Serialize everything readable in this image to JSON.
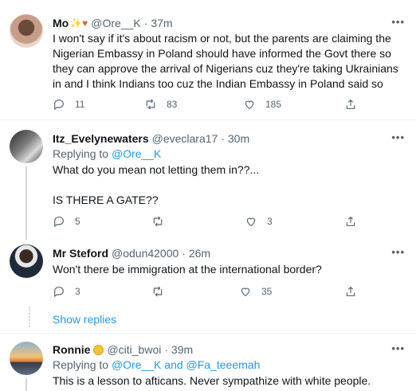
{
  "tweets": [
    {
      "name": "Mo",
      "handle": "@Ore__K",
      "time": "· 37m",
      "text": "I won't say if it's about racism or not, but the parents are claiming the Nigerian Embassy in Poland should have informed the Govt there so they can approve the arrival of Nigerians cuz they're taking Ukrainians in and I think Indians too cuz the Indian Embassy in Poland said so",
      "replies": "11",
      "retweets": "83",
      "likes": "185"
    },
    {
      "name": "Itz_Evelynewaters",
      "handle": "@eveclara17",
      "time": "· 30m",
      "replying_prefix": "Replying to ",
      "replying_handle": "@Ore__K",
      "text_line1": "What do you mean not letting them in??...",
      "text_line2": "IS THERE A GATE??",
      "replies": "5",
      "retweets": "",
      "likes": "3"
    },
    {
      "name": "Mr Steford",
      "handle": "@odun42000",
      "time": "· 26m",
      "text": "Won't there be immigration at the international border?",
      "replies": "3",
      "retweets": "",
      "likes": "35"
    },
    {
      "name": "Ronnie",
      "handle": "@citi_bwoi",
      "time": "· 39m",
      "replying_prefix": "Replying to ",
      "replying_handle1": "@Ore__K",
      "replying_and": " and ",
      "replying_handle2": "@Fa_teeemah",
      "text": "This is a lesson to afticans. Never sympathize with white people."
    }
  ],
  "show_replies": "Show replies",
  "more": "•••",
  "icons": {
    "reply": "reply-icon",
    "retweet": "retweet-icon",
    "like": "heart-icon",
    "share": "share-icon"
  },
  "colors": {
    "link": "#1d9bf0",
    "secondary": "#536471",
    "divider": "#eff3f4"
  }
}
